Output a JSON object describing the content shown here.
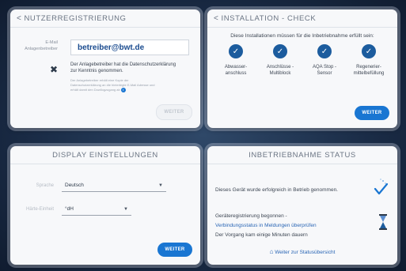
{
  "registration": {
    "title": "NUTZERREGISTRIERUNG",
    "email_label_1": "E-Mail",
    "email_label_2": "Anlagenbetreiber",
    "email_value": "betreiber@bwt.de",
    "consent_1": "Der Anlagebetreiber hat die Datenschutzerklärung",
    "consent_2": "zur Kenntnis genommen.",
    "small_note_1": "Der Anlagebetreiber erhält eine Kopie der",
    "small_note_2": "Datenschutzerklärung an die hinterlegte E-Mail Adresse und",
    "small_note_3": "erhält damit den Dowllogzugang ab",
    "info_glyph": "i",
    "next_button": "WEITER"
  },
  "installation_check": {
    "title": "INSTALLATION - CHECK",
    "intro": "Diese Installationen müssen für die Inbetriebnahme erfüllt sein:",
    "items": [
      {
        "line1": "Abwasser-",
        "line2": "anschluss"
      },
      {
        "line1": "Anschlüsse -",
        "line2": "Multiblock"
      },
      {
        "line1": "AQA Stop -",
        "line2": "Sensor"
      },
      {
        "line1": "Regenerier-",
        "line2": "mittelbefüllung"
      }
    ],
    "next_button": "WEITER"
  },
  "display_settings": {
    "title": "DISPLAY EINSTELLUNGEN",
    "language_label": "Sprache",
    "language_value": "Deutsch",
    "hardness_label": "Härte-Einheit",
    "hardness_value": "°dH",
    "next_button": "WEITER"
  },
  "commissioning_status": {
    "title": "INBETRIEBNAHME STATUS",
    "line1": "Dieses Gerät wurde erfolgreich in Betrieb genommen.",
    "line2": "Geräteregistrierung begonnen -",
    "line3": "Verbindungsstatus in Meldungen überprüfen",
    "line4": "Der Vorgang kam einige Minuten dauern",
    "status_link": "Weiter zur Statusübersicht"
  },
  "colors": {
    "accent": "#1976d2",
    "check_circle": "#1c5c9e",
    "background": "#1b2d48"
  }
}
